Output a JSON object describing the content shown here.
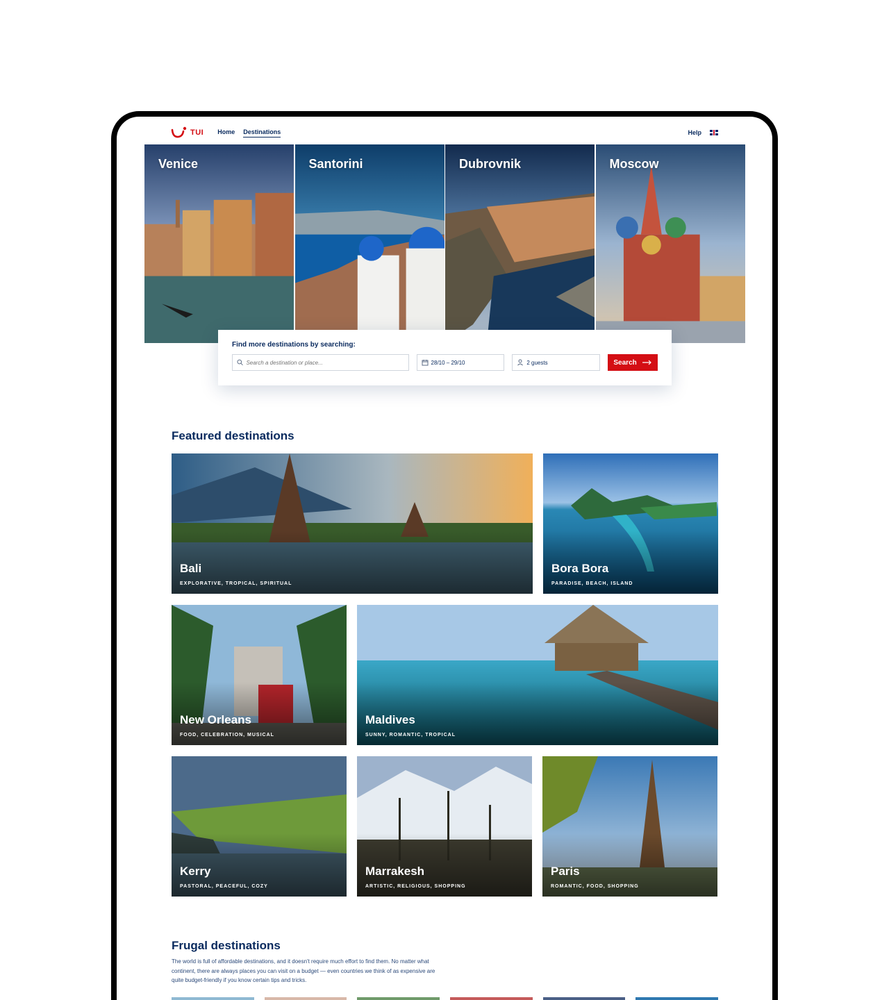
{
  "brand": {
    "name": "TUI",
    "color": "#d40e14",
    "navy": "#092a5e"
  },
  "nav": {
    "links": [
      {
        "label": "Home",
        "active": false
      },
      {
        "label": "Destinations",
        "active": true
      }
    ],
    "help": "Help",
    "language_icon": "uk-flag-icon"
  },
  "hero": {
    "panels": [
      {
        "title": "Venice"
      },
      {
        "title": "Santorini"
      },
      {
        "title": "Dubrovnik"
      },
      {
        "title": "Moscow"
      }
    ]
  },
  "search": {
    "heading": "Find more destinations by searching:",
    "destination_placeholder": "Search a destination or place...",
    "dates": "28/10 – 29/10",
    "guests": "2 guests",
    "button": "Search",
    "icons": [
      "search-icon",
      "calendar-icon",
      "person-icon",
      "arrow-right-icon"
    ]
  },
  "featured": {
    "title": "Featured destinations",
    "cards": [
      {
        "title": "Bali",
        "tags": "Explorative, tropical, spiritual"
      },
      {
        "title": "Bora Bora",
        "tags": "Paradise, beach, island"
      },
      {
        "title": "New Orleans",
        "tags": "Food, celebration, musical"
      },
      {
        "title": "Maldives",
        "tags": "Sunny, romantic, tropical"
      },
      {
        "title": "Kerry",
        "tags": "Pastoral, peaceful, cozy"
      },
      {
        "title": "Marrakesh",
        "tags": "Artistic, religious, shopping"
      },
      {
        "title": "Paris",
        "tags": "Romantic, food, shopping"
      }
    ]
  },
  "frugal": {
    "title": "Frugal destinations",
    "text": "The world is full of affordable destinations, and it doesn't require much effort to find them. No matter what continent, there are always places you can visit on a budget — even countries we think of as expensive are quite budget-friendly if you know certain tips and tricks."
  }
}
